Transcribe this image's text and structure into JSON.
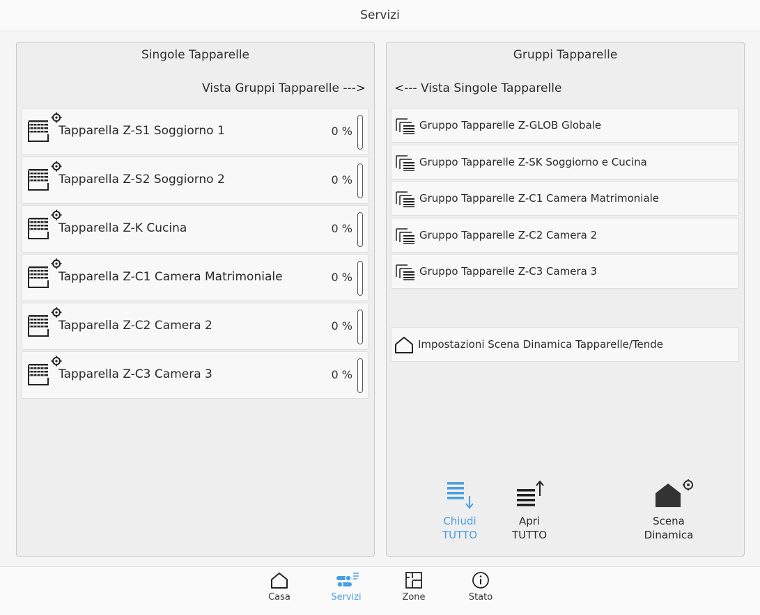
{
  "header": {
    "title": "Servizi"
  },
  "left_panel": {
    "title": "Singole Tapparelle",
    "nav_link": "Vista Gruppi Tapparelle --->",
    "blinds": [
      {
        "label": "Tapparella Z-S1 Soggiorno 1",
        "percent": "0 %"
      },
      {
        "label": "Tapparella Z-S2 Soggiorno 2",
        "percent": "0 %"
      },
      {
        "label": "Tapparella Z-K Cucina",
        "percent": "0 %"
      },
      {
        "label": "Tapparella Z-C1 Camera Matrimoniale",
        "percent": "0 %"
      },
      {
        "label": "Tapparella Z-C2 Camera 2",
        "percent": "0 %"
      },
      {
        "label": "Tapparella Z-C3 Camera 3",
        "percent": "0 %"
      }
    ]
  },
  "right_panel": {
    "title": "Gruppi Tapparelle",
    "nav_link": "<--- Vista Singole Tapparelle",
    "groups": [
      {
        "label": "Gruppo Tapparelle Z-GLOB Globale"
      },
      {
        "label": "Gruppo Tapparelle Z-SK Soggiorno e Cucina"
      },
      {
        "label": "Gruppo Tapparelle Z-C1 Camera Matrimoniale"
      },
      {
        "label": "Gruppo Tapparelle Z-C2 Camera 2"
      },
      {
        "label": "Gruppo Tapparelle Z-C3 Camera 3"
      }
    ],
    "scene_settings": {
      "label": "Impostazioni Scena Dinamica Tapparelle/Tende"
    },
    "actions": {
      "close_all": {
        "line1": "Chiudi",
        "line2": "TUTTO"
      },
      "open_all": {
        "line1": "Apri",
        "line2": "TUTTO"
      },
      "dynamic_scene": {
        "line1": "Scena",
        "line2": "Dinamica"
      }
    }
  },
  "bottom_nav": {
    "tabs": [
      {
        "label": "Casa",
        "icon": "house-icon"
      },
      {
        "label": "Servizi",
        "icon": "services-icon"
      },
      {
        "label": "Zone",
        "icon": "floorplan-icon"
      },
      {
        "label": "Stato",
        "icon": "info-icon"
      }
    ],
    "active_tab": "Servizi"
  },
  "colors": {
    "accent": "#4a9fe3",
    "text": "#2a2a2a",
    "panel_bg": "#eeeeee"
  }
}
